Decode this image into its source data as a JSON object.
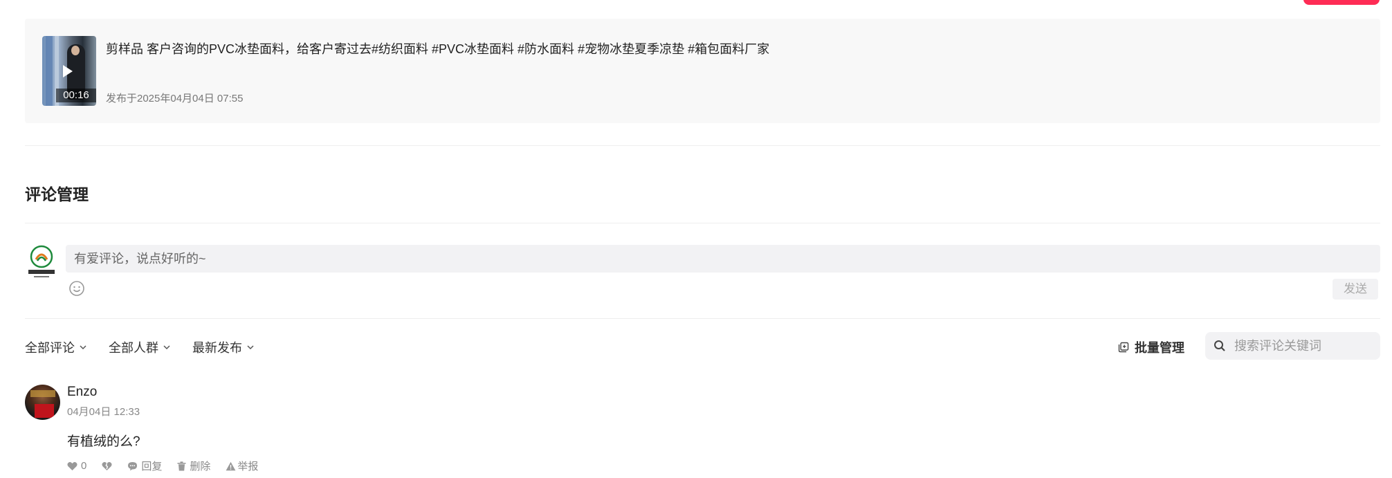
{
  "video": {
    "duration": "00:16",
    "title": "剪样品 客户咨询的PVC冰垫面料，给客户寄过去#纺织面料 #PVC冰垫面料 #防水面料 #宠物冰垫夏季凉垫 #箱包面料厂家",
    "published": "发布于2025年04月04日 07:55"
  },
  "section": {
    "title": "评论管理"
  },
  "composer": {
    "placeholder": "有爱评论，说点好听的~",
    "send_label": "发送"
  },
  "filters": {
    "all_comments": "全部评论",
    "all_audience": "全部人群",
    "latest": "最新发布",
    "batch_manage": "批量管理",
    "search_placeholder": "搜索评论关键词"
  },
  "comments": [
    {
      "user": "Enzo",
      "time": "04月04日 12:33",
      "text": "有植绒的么?",
      "likes": "0",
      "reply_label": "回复",
      "delete_label": "删除",
      "report_label": "举报"
    }
  ],
  "colors": {
    "accent": "#fe2c55",
    "card_bg": "#f8f8f8",
    "input_bg": "#f2f2f4"
  }
}
